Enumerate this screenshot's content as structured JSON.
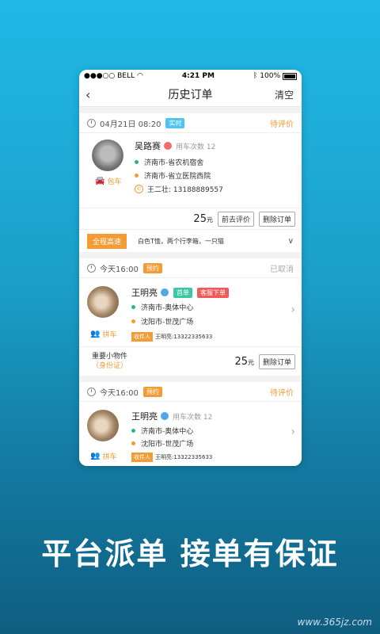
{
  "statusbar": {
    "carrier": "●●●○○ BELL",
    "time": "4:21 PM",
    "battery": "100%"
  },
  "nav": {
    "back": "‹",
    "title": "历史订单",
    "right": "清空"
  },
  "orders": [
    {
      "datetime": "04月21日 08:20",
      "tag": "实时",
      "status": "待评价",
      "name": "吴路赛",
      "sub": "用车次数 12",
      "from": "济南市-省农机宿舍",
      "to": "济南市-省立医院西院",
      "contact": "王二壮: 13188889557",
      "car_type": "包车",
      "price": "25",
      "price_unit": "元",
      "btn1": "前去评价",
      "btn2": "删除订单",
      "extra_tag": "全程高速",
      "extra_text": "白色T恤，两个行李箱，一只猫"
    },
    {
      "datetime": "今天16:00",
      "tag": "预约",
      "status": "已取消",
      "name": "王明亮",
      "tag_a": "首单",
      "tag_b": "客服下单",
      "from": "济南市-奥体中心",
      "to": "沈阳市-世茂广场",
      "car_type": "拼车",
      "recv_label": "收件人",
      "recv": "王明亮:13322335633",
      "item": "重要小物件",
      "item_note": "（身份证）",
      "price": "25",
      "price_unit": "元",
      "btn2": "删除订单"
    },
    {
      "datetime": "今天16:00",
      "tag": "预约",
      "status": "待评价",
      "name": "王明亮",
      "sub": "用车次数 12",
      "from": "济南市-奥体中心",
      "to": "沈阳市-世茂广场",
      "car_type": "拼车",
      "recv_label": "收件人",
      "recv": "王明亮:13322335633"
    }
  ],
  "slogan": "平台派单 接单有保证",
  "watermark": "www.365jz.com"
}
